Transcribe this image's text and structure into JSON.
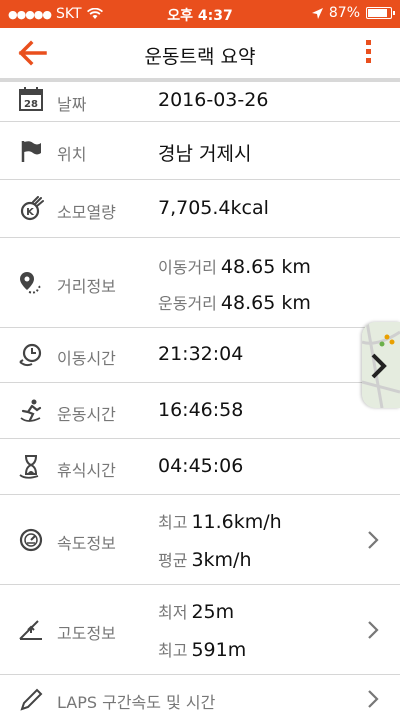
{
  "status_bar": {
    "carrier": "SKT",
    "time": "오후 4:37",
    "battery": "87%"
  },
  "nav": {
    "title": "운동트랙 요약"
  },
  "rows": {
    "date": {
      "label": "날짜",
      "value": "2016-03-26",
      "icon_text": "28"
    },
    "location": {
      "label": "위치",
      "value": "경남 거제시"
    },
    "calories": {
      "label": "소모열량",
      "value": "7,705.4kcal"
    },
    "distance": {
      "label": "거리정보",
      "move_label": "이동거리",
      "move_value": "48.65 km",
      "exercise_label": "운동거리",
      "exercise_value": "48.65 km"
    },
    "move_time": {
      "label": "이동시간",
      "value": "21:32:04"
    },
    "exercise_time": {
      "label": "운동시간",
      "value": "16:46:58"
    },
    "rest_time": {
      "label": "휴식시간",
      "value": "04:45:06"
    },
    "speed": {
      "label": "속도정보",
      "max_label": "최고",
      "max_value": "11.6km/h",
      "avg_label": "평균",
      "avg_value": "3km/h"
    },
    "altitude": {
      "label": "고도정보",
      "min_label": "최저",
      "min_value": "25m",
      "max_label": "최고",
      "max_value": "591m"
    },
    "laps": {
      "label": "LAPS 구간속도 및 시간"
    }
  },
  "colors": {
    "accent": "#e94f1d",
    "label_gray": "#777777",
    "divider": "#d6d6d6"
  }
}
